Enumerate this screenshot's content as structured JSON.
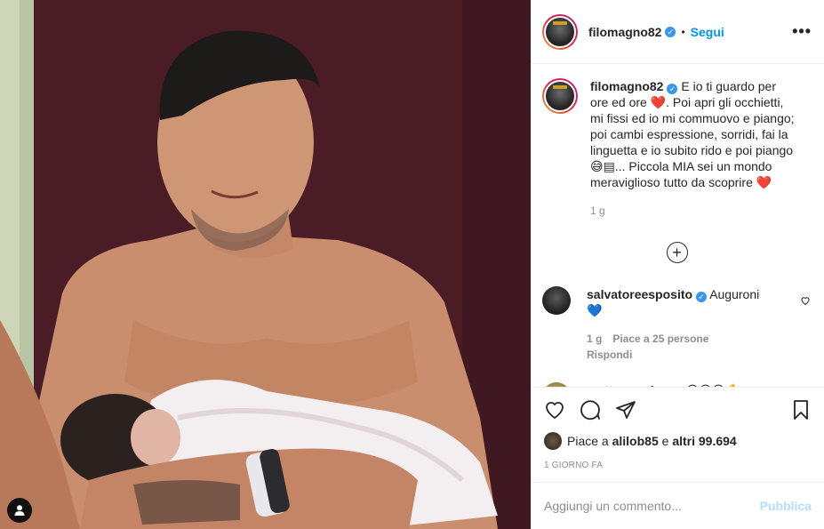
{
  "post": {
    "username": "filomagno82",
    "follow_label": "Segui",
    "more_label": "•••",
    "dot": "•",
    "verified_mark": "✓"
  },
  "caption": {
    "username": "filomagno82",
    "text_1": "E io ti guardo per ore ed ore ",
    "heart_1": "❤️",
    "text_2": ". Poi apri gli occhietti, mi fissi ed io mi commuovo e piango; poi cambi espressione, sorridi, fai la linguetta e io subito rido e poi piango ",
    "emoji_2": "😅▤",
    "text_3": "... Piccola MIA sei un mondo meraviglioso tutto da scoprire ",
    "heart_2": "❤️",
    "time": "1 g"
  },
  "load_more_label": "+",
  "comments": [
    {
      "username": "salvatoreesposito",
      "text": "Auguroni",
      "emoji": "💙",
      "time": "1 g",
      "likes": "Piace a 25 persone",
      "reply": "Rispondi"
    },
    {
      "username": "matteorestivo",
      "emoji": "😍😍😍💪"
    }
  ],
  "likes": {
    "prefix": "Piace a ",
    "user": "alilob85",
    "middle": " e ",
    "others": "altri 99.694"
  },
  "time_ago": "1 GIORNO FA",
  "comment_input": {
    "placeholder": "Aggiungi un commento...",
    "publish_label": "Pubblica"
  },
  "colors": {
    "accent": "#0095f6",
    "verified": "#3897f0",
    "muted": "#8e8e8e",
    "publish_disabled": "#b2dffc"
  },
  "icons": [
    "heart-icon",
    "comment-icon",
    "share-icon",
    "save-icon",
    "user-tag-icon",
    "more-icon",
    "add-icon"
  ]
}
